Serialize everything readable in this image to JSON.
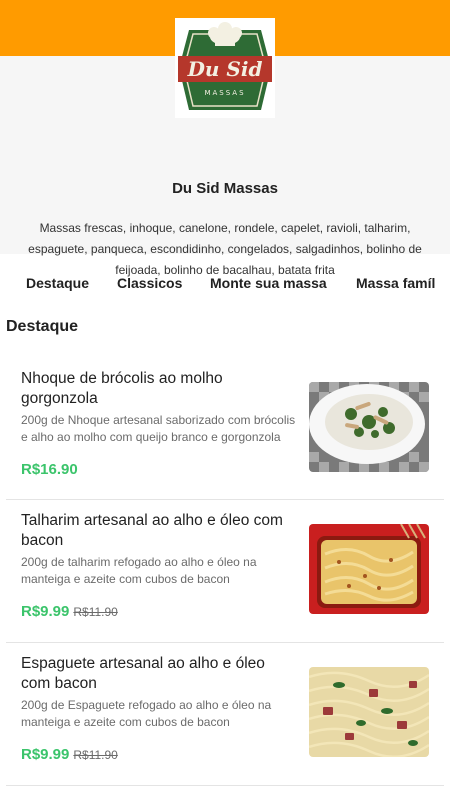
{
  "colors": {
    "accent": "#ff9b00",
    "price": "#3bc46b",
    "header_bg": "#f6f6f6",
    "logo_green": "#2e6b35",
    "logo_red": "#b5372b"
  },
  "store": {
    "name": "Du Sid Massas",
    "description": "Massas frescas, inhoque, canelone, rondele, capelet, ravioli, talharim, espaguete, panqueca, escondidinho, congelados, salgadinhos, bolinho de feijoada, bolinho de bacalhau, batata frita",
    "logo": {
      "main_text": "Du Sid",
      "sub_text": "MASSAS",
      "icon": "chef-hat-icon"
    }
  },
  "tabs": [
    {
      "label": "Destaque"
    },
    {
      "label": "Classicos"
    },
    {
      "label": "Monte sua massa"
    },
    {
      "label": "Massa famíl"
    }
  ],
  "section": {
    "title": "Destaque"
  },
  "items": [
    {
      "name": "Nhoque de brócolis ao molho gorgonzola",
      "description": "200g de Nhoque artesanal saborizado com brócolis e alho ao molho com queijo branco e gorgonzola",
      "price": "R$16.90",
      "old_price": ""
    },
    {
      "name": "Talharim artesanal ao alho e óleo com bacon",
      "description": "200g de talharim refogado ao alho e óleo na manteiga e azeite com cubos de bacon",
      "price": "R$9.99",
      "old_price": "R$11.90"
    },
    {
      "name": "Espaguete artesanal ao alho e óleo com bacon",
      "description": "200g de Espaguete refogado ao alho e óleo na manteiga e azeite com cubos de bacon",
      "price": "R$9.99",
      "old_price": "R$11.90"
    }
  ]
}
